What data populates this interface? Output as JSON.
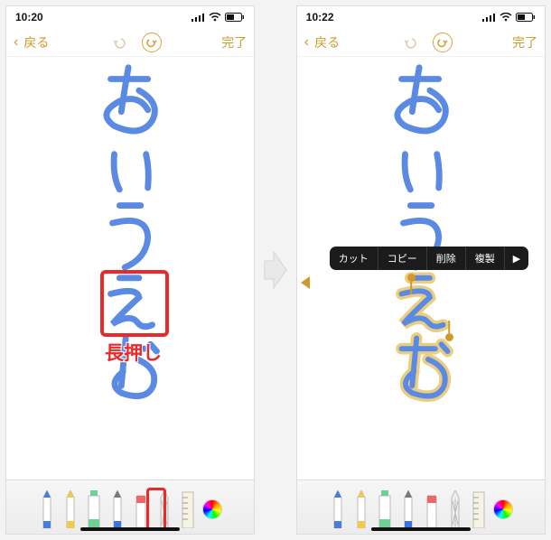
{
  "left": {
    "time": "10:20",
    "back_label": "戻る",
    "done_label": "完了",
    "highlight_label": "長押し",
    "strokes": "あいうえお"
  },
  "right": {
    "time": "10:22",
    "back_label": "戻る",
    "done_label": "完了",
    "strokes": "あいうえお",
    "menu": {
      "cut": "カット",
      "copy": "コピー",
      "delete": "削除",
      "duplicate": "複製",
      "more": "▶"
    }
  },
  "tools": [
    "pen-blue",
    "pen-yellow",
    "highlighter",
    "pencil",
    "eraser",
    "lasso",
    "ruler",
    "color-wheel"
  ]
}
